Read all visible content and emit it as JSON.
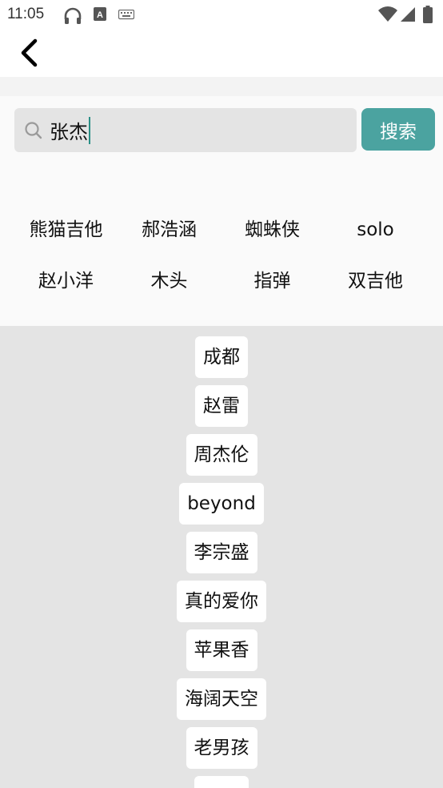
{
  "status_bar": {
    "time": "11:05",
    "icons": [
      "headphones-icon",
      "font-a-icon",
      "keyboard-icon",
      "wifi-icon",
      "cell-signal-icon",
      "battery-icon"
    ]
  },
  "app_bar": {
    "back_icon": "chevron-left-icon"
  },
  "search": {
    "query": "张杰",
    "icon": "search-icon",
    "button_label": "搜索"
  },
  "hot_tags": [
    "熊猫吉他",
    "郝浩涵",
    "蜘蛛侠",
    "solo",
    "赵小洋",
    "木头",
    "指弹",
    "双吉他"
  ],
  "history": [
    "成都",
    "赵雷",
    "周杰伦",
    "beyond",
    "李宗盛",
    "真的爱你",
    "苹果香",
    "海阔天空",
    "老男孩",
    ""
  ],
  "colors": {
    "accent": "#4ba3a0",
    "caret": "#2a8f86",
    "history_background": "#e4e4e4",
    "search_box": "#e4e4e4"
  }
}
